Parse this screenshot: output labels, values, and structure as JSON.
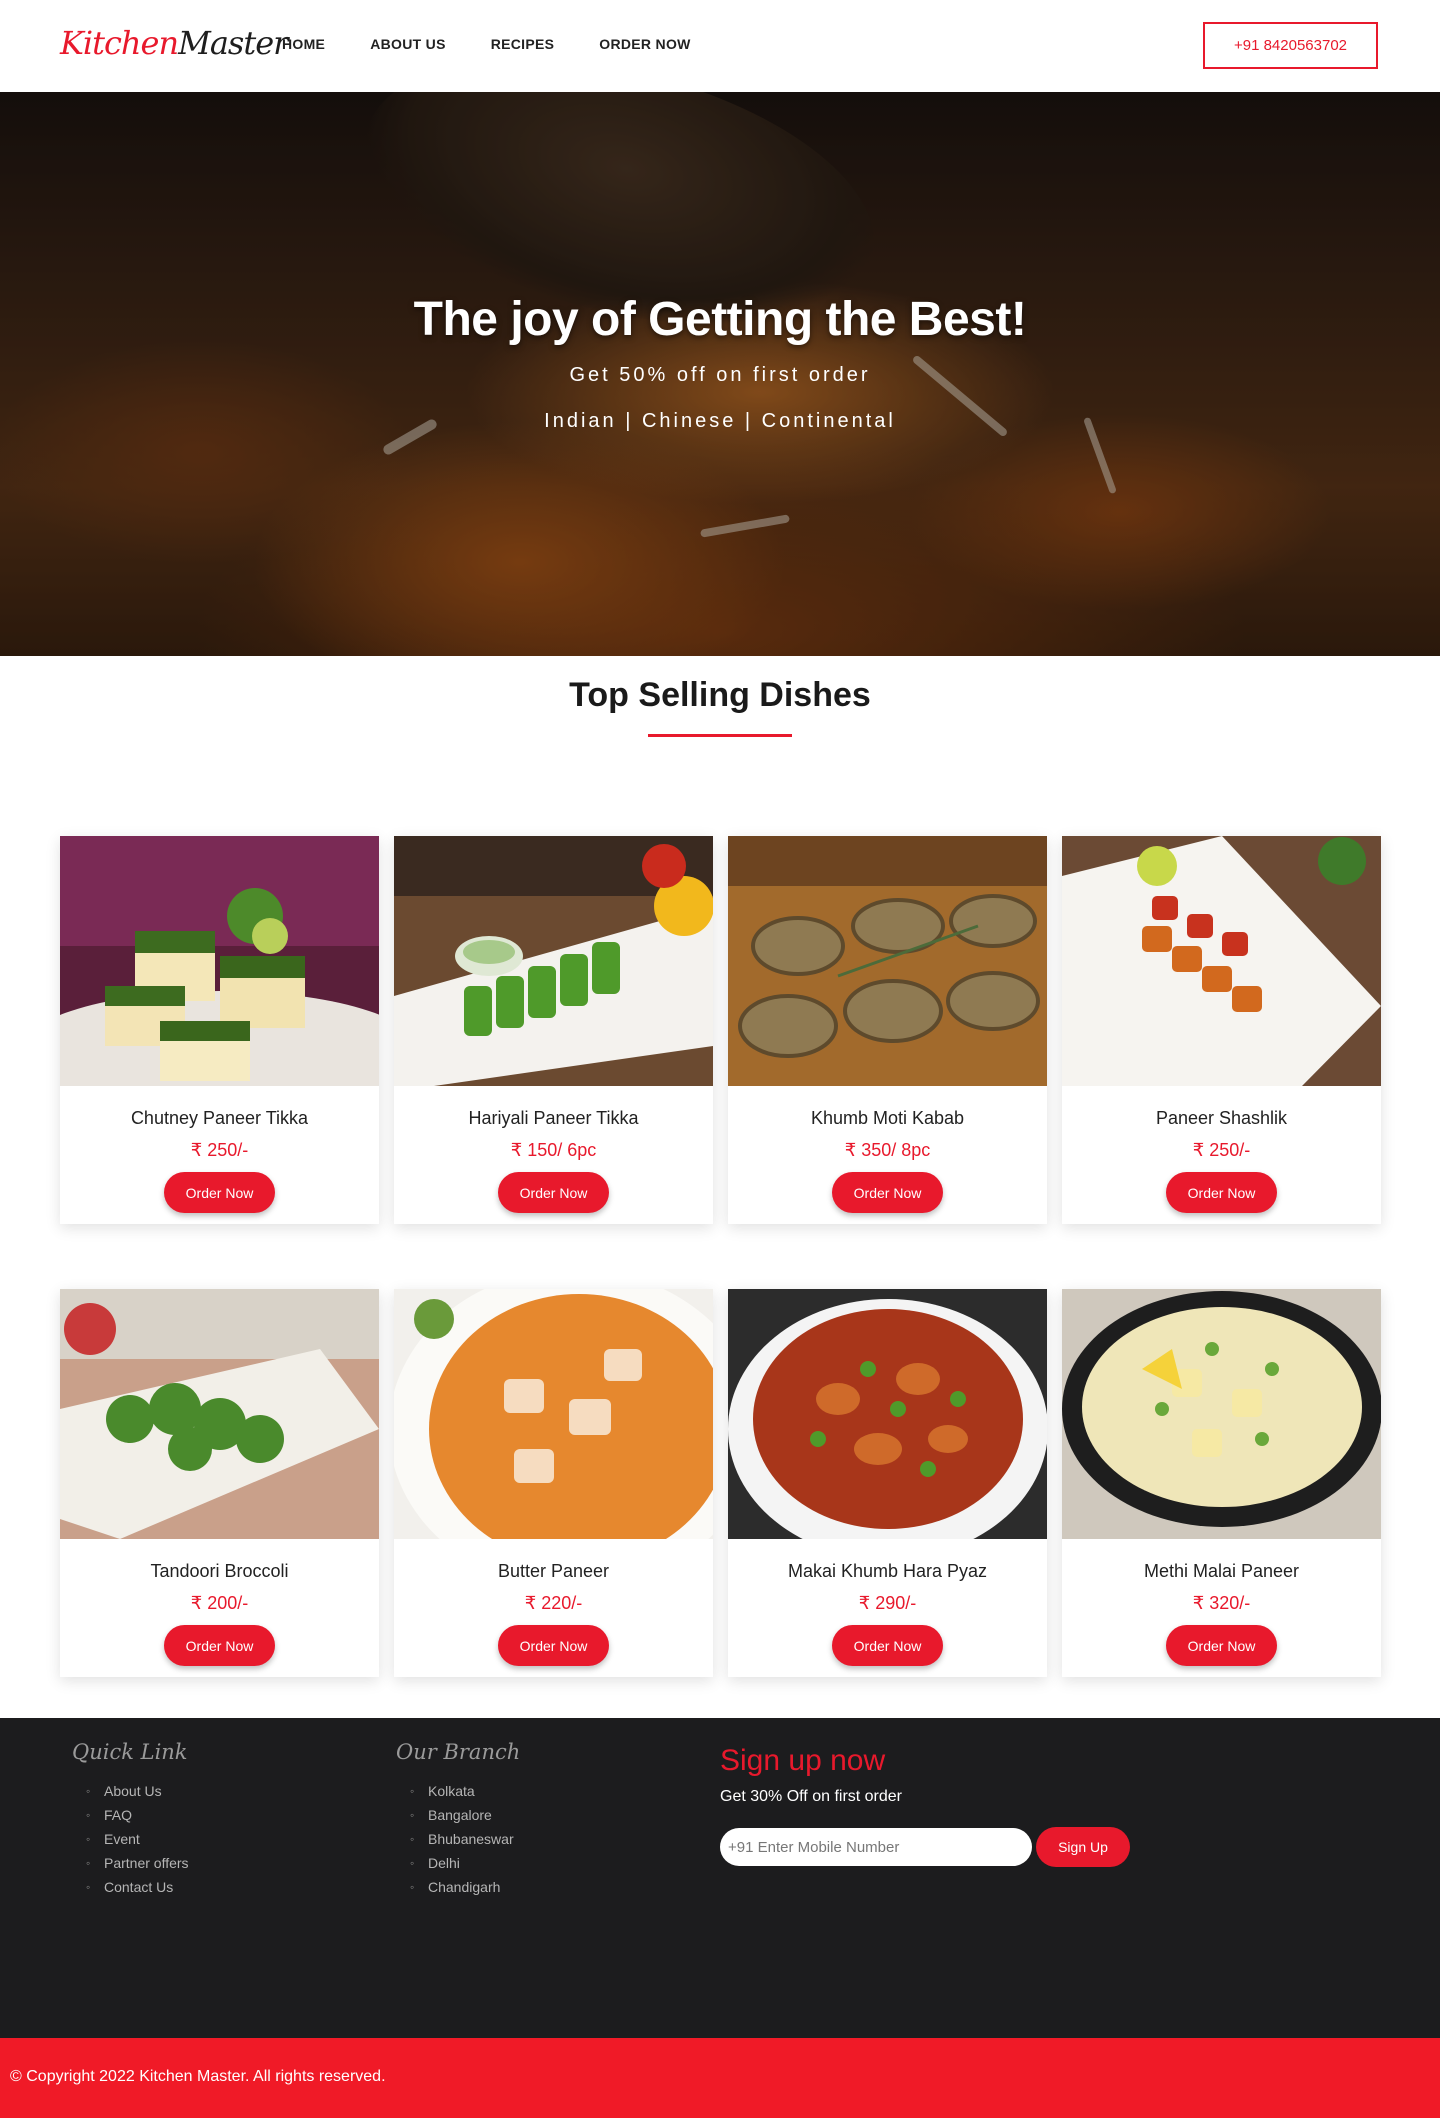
{
  "brand": {
    "part1": "Kitchen",
    "part2": "Master"
  },
  "nav": {
    "items": [
      "HOME",
      "ABOUT US",
      "RECIPES",
      "ORDER NOW"
    ],
    "phone": "+91 8420563702"
  },
  "hero": {
    "title": "The joy of Getting the Best!",
    "subtitle": "Get 50% off on first order",
    "cuisines": "Indian | Chinese | Continental"
  },
  "section": {
    "title": "Top Selling Dishes"
  },
  "dishes": [
    {
      "name": "Chutney Paneer Tikka",
      "price": "₹ 250/-",
      "button": "Order Now",
      "image": "chutney-paneer-tikka-photo"
    },
    {
      "name": "Hariyali Paneer Tikka",
      "price": "₹ 150/ 6pc",
      "button": "Order Now",
      "image": "hariyali-paneer-tikka-photo"
    },
    {
      "name": "Khumb Moti Kabab",
      "price": "₹ 350/ 8pc",
      "button": "Order Now",
      "image": "khumb-moti-kabab-photo"
    },
    {
      "name": "Paneer Shashlik",
      "price": "₹ 250/-",
      "button": "Order Now",
      "image": "paneer-shashlik-photo"
    },
    {
      "name": "Tandoori Broccoli",
      "price": "₹ 200/-",
      "button": "Order Now",
      "image": "tandoori-broccoli-photo"
    },
    {
      "name": "Butter Paneer",
      "price": "₹ 220/-",
      "button": "Order Now",
      "image": "butter-paneer-photo"
    },
    {
      "name": "Makai Khumb Hara Pyaz",
      "price": "₹ 290/-",
      "button": "Order Now",
      "image": "makai-khumb-hara-pyaz-photo"
    },
    {
      "name": "Methi Malai Paneer",
      "price": "₹ 320/-",
      "button": "Order Now",
      "image": "methi-malai-paneer-photo"
    }
  ],
  "footer": {
    "quick_link": {
      "title": "Quick Link",
      "items": [
        "About Us",
        "FAQ",
        "Event",
        "Partner offers",
        "Contact Us"
      ]
    },
    "branch": {
      "title": "Our Branch",
      "items": [
        "Kolkata",
        "Bangalore",
        "Bhubaneswar",
        "Delhi",
        "Chandigarh"
      ]
    },
    "signup": {
      "title": "Sign up now",
      "subtitle": "Get 30% Off on first order",
      "placeholder": "+91 Enter Mobile Number",
      "button": "Sign Up"
    },
    "copyright": "© Copyright 2022 Kitchen Master. All rights reserved."
  },
  "colors": {
    "accent": "#e8192c",
    "footer_bg": "#1c1c1e",
    "copyright_bg": "#f01a27"
  }
}
